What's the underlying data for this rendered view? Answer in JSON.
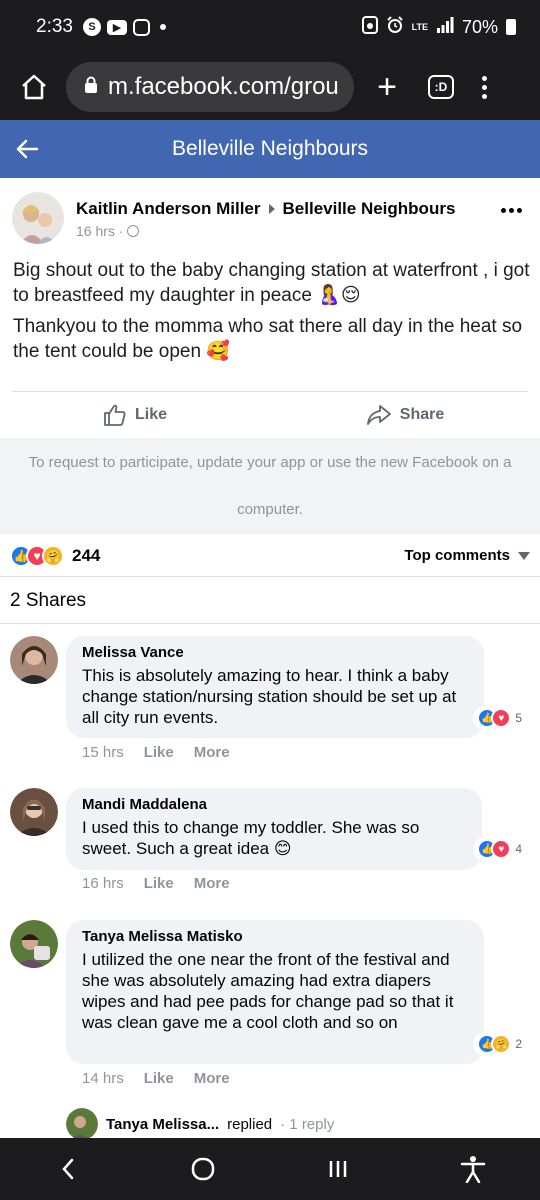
{
  "status_bar": {
    "time": "2:33",
    "battery": "70%",
    "network": "LTE",
    "icons": [
      "shazam-icon",
      "youtube-icon",
      "instagram-icon",
      "notification-dot",
      "sim-icon",
      "alarm-icon",
      "signal-icon",
      "battery-icon"
    ]
  },
  "browser": {
    "url": "m.facebook.com/grou",
    "tabs_label": ":D"
  },
  "group": {
    "title": "Belleville Neighbours"
  },
  "post": {
    "author": "Kaitlin Anderson Miller",
    "group": "Belleville Neighbours",
    "time": "16 hrs ·",
    "paragraphs": [
      "Big shout out to the baby changing station at waterfront , i got to breastfeed my daughter in peace 🤱😌",
      "Thankyou to the momma who sat there all day in the heat so the tent could be open 🥰"
    ],
    "like_label": "Like",
    "share_label": "Share",
    "notice_line1": "To request to participate, update your app or use the new Facebook on a",
    "notice_line2": "computer.",
    "reaction_count": "244",
    "top_comments_label": "Top comments",
    "shares_label": "2 Shares"
  },
  "comments": [
    {
      "name": "Melissa Vance",
      "text": "This is absolutely amazing to hear. I think a baby change station/nursing station should be set up at all city run events.",
      "reactions": "5",
      "time": "15 hrs",
      "like": "Like",
      "more": "More"
    },
    {
      "name": "Mandi Maddalena",
      "text": "I used this to change my toddler. She was so sweet. Such a great idea 😊",
      "reactions": "4",
      "time": "16 hrs",
      "like": "Like",
      "more": "More"
    },
    {
      "name": "Tanya Melissa Matisko",
      "text": "I utilized the one near the front of the festival and she was absolutely amazing had extra diapers wipes and had pee pads for change pad so that it was clean gave me a cool cloth and so on",
      "reactions": "2",
      "time": "14 hrs",
      "like": "Like",
      "more": "More"
    }
  ],
  "reply": {
    "name": "Tanya Melissa...",
    "action": "replied",
    "count": "· 1 reply"
  },
  "colors": {
    "facebook_blue": "#4267b2",
    "like_blue": "#1877f2",
    "love_red": "#f33e58",
    "care_yellow": "#f7b125",
    "bubble_gray": "#f0f2f5"
  }
}
